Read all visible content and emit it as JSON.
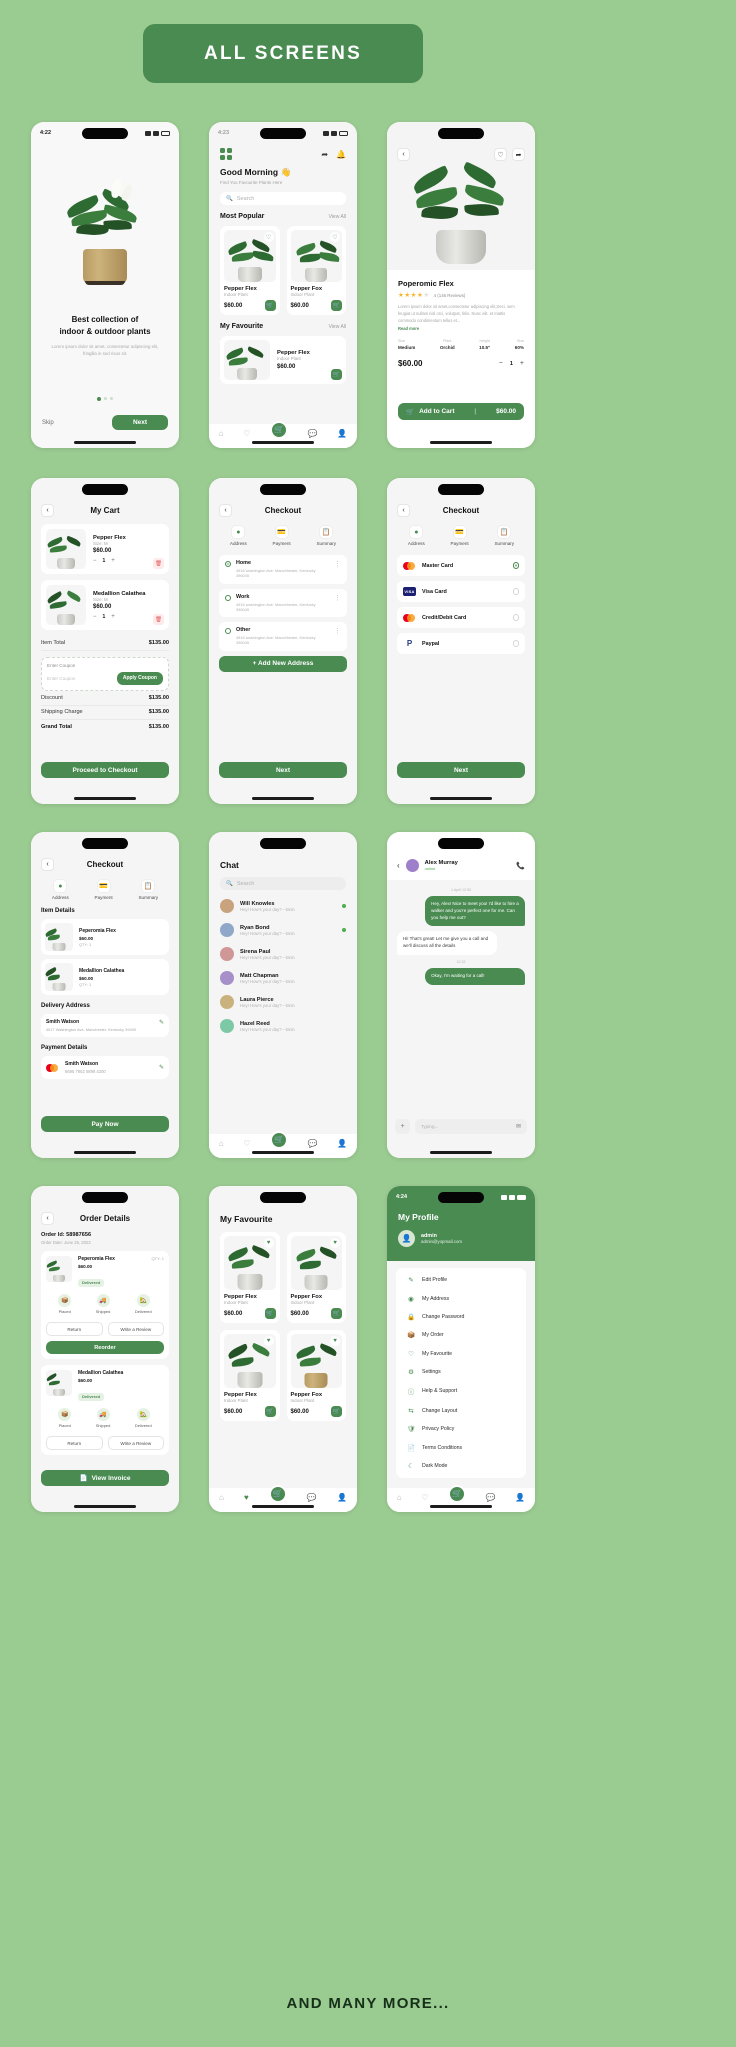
{
  "banner": {
    "title": "ALL SCREENS"
  },
  "footer": {
    "text": "AND MANY MORE..."
  },
  "theme": {
    "bg": "#9ACB91",
    "accent": "#4A8B52",
    "card": "#FFFFFF",
    "screen_bg": "#F4F5F4"
  },
  "screens": [
    {
      "id": "onboarding",
      "status_time": "4:22",
      "headline_line1": "Best collection of",
      "headline_line2": "indoor & outdoor plants",
      "body": "Lorem ipsum dolor sit amet, consectetur adipiscing elit, fringilla in sed risus sit.",
      "skip_label": "Skip",
      "next_label": "Next",
      "dots": 3,
      "active_dot": 0
    },
    {
      "id": "home",
      "status_time": "4:23",
      "greeting": "Good Morning",
      "greeting_emoji": "👋",
      "subtitle": "Find You Favourite Plants Here",
      "search_placeholder": "Search",
      "sections": [
        {
          "title": "Most Popular",
          "view_all": "View All",
          "products": [
            {
              "name": "Pepper Flex",
              "sub": "Indoor Plant",
              "price": "$60.00"
            },
            {
              "name": "Pepper Fox",
              "sub": "Indoor Plant",
              "price": "$60.00"
            }
          ]
        },
        {
          "title": "My Favourite",
          "view_all": "View All",
          "products": [
            {
              "name": "Pepper Flex",
              "sub": "Indoor Plant",
              "price": "$60.00"
            }
          ]
        }
      ],
      "tabs": [
        "home-icon",
        "heart-icon",
        "cart-icon",
        "chat-icon",
        "person-icon"
      ]
    },
    {
      "id": "product-detail",
      "name": "Poperomic Flex",
      "rating_stars": 4,
      "rating_text": "4 (146 Reviews)",
      "description": "Lorem ipsum dolor sit amet,consectetur adipiscing elit,Deci, sem feugiat ut nullam nisl orci, volutpat, felis. Nunc elit. et mattis commodo condimentum tellus et...",
      "read_more": "Read more",
      "specs": [
        {
          "label": "Size",
          "value": "Medium"
        },
        {
          "label": "Plant",
          "value": "Orchid"
        },
        {
          "label": "Height",
          "value": "10.5\""
        },
        {
          "label": "Size",
          "value": "60%"
        }
      ],
      "price": "$60.00",
      "qty": "1",
      "add_to_cart": "Add to Cart",
      "cart_price": "$60.00"
    },
    {
      "id": "my-cart",
      "title": "My Cart",
      "items": [
        {
          "name": "Pepper Flex",
          "sub": "Size: M",
          "price": "$60.00",
          "qty": "1"
        },
        {
          "name": "Medallion Calathea",
          "sub": "Size: M",
          "price": "$60.00",
          "qty": "1"
        }
      ],
      "item_total_label": "Item Total",
      "item_total": "$135.00",
      "coupon_label": "Enter Coupon",
      "coupon_placeholder": "Enter Coupon",
      "apply_label": "Apply Coupon",
      "discount_label": "Discount",
      "discount": "$135.00",
      "shipping_label": "Shipping Charge",
      "shipping": "$135.00",
      "grand_label": "Grand Total",
      "grand": "$135.00",
      "checkout_btn": "Proceed to Checkout"
    },
    {
      "id": "checkout-address",
      "title": "Checkout",
      "steps": [
        {
          "label": "Address",
          "icon": "location-icon"
        },
        {
          "label": "Payment",
          "icon": "wallet-icon"
        },
        {
          "label": "Summary",
          "icon": "clipboard-icon"
        }
      ],
      "addresses": [
        {
          "type": "Home",
          "line": "4516 washington Ave. Manchhester, Kentucky 396045",
          "selected": true
        },
        {
          "type": "Work",
          "line": "4516 washington Ave. Manchhester, Kentucky 396045",
          "selected": false
        },
        {
          "type": "Other",
          "line": "4516 washington Ave. Manchhester, Kentucky 396045",
          "selected": false
        }
      ],
      "add_address": "+   Add New Address",
      "next_btn": "Next"
    },
    {
      "id": "checkout-payment",
      "title": "Checkout",
      "steps": [
        {
          "label": "Address",
          "icon": "location-icon"
        },
        {
          "label": "Payment",
          "icon": "wallet-icon"
        },
        {
          "label": "Summary",
          "icon": "clipboard-icon"
        }
      ],
      "methods": [
        {
          "name": "Master Card",
          "brand": "mastercard",
          "selected": true
        },
        {
          "name": "Visa Card",
          "brand": "visa",
          "selected": false
        },
        {
          "name": "Credit/Debit Card",
          "brand": "mastercard",
          "selected": false
        },
        {
          "name": "Paypal",
          "brand": "paypal",
          "selected": false
        }
      ],
      "next_btn": "Next"
    },
    {
      "id": "checkout-summary",
      "title": "Checkout",
      "steps": [
        {
          "label": "Address",
          "icon": "location-icon"
        },
        {
          "label": "Payment",
          "icon": "wallet-icon"
        },
        {
          "label": "Summary",
          "icon": "clipboard-icon"
        }
      ],
      "item_details_label": "Item Details",
      "items": [
        {
          "name": "Peperomia Flex",
          "price": "$60.00",
          "qty": "QTY: 1"
        },
        {
          "name": "Medallion Calathea",
          "price": "$60.00",
          "qty": "QTY: 1"
        }
      ],
      "delivery_label": "Delivery Address",
      "delivery_name": "Smith Watson",
      "delivery_addr": "4517 Washington Ave. Manchester, Kentucky 39495",
      "payment_label": "Payment Details",
      "payment_name": "Smith Watson",
      "payment_card": "6695 7852 5898 4200",
      "pay_btn": "Pay Now"
    },
    {
      "id": "chat-list",
      "title": "Chat",
      "search_placeholder": "Search",
      "contacts": [
        {
          "name": "Will Knowles",
          "msg": "Hey! How's your day? - 5min",
          "online": true
        },
        {
          "name": "Ryan Bond",
          "msg": "Hey! How's your day? - 5min",
          "online": true
        },
        {
          "name": "Sirena Paul",
          "msg": "Hey! How's your day? - 5min",
          "online": false
        },
        {
          "name": "Matt Chapman",
          "msg": "Hey! How's your day? - 5min",
          "online": false
        },
        {
          "name": "Laura Pierce",
          "msg": "Hey! How's your day? - 5min",
          "online": false
        },
        {
          "name": "Hazel Reed",
          "msg": "Hey! How's your day? - 5min",
          "online": false
        }
      ]
    },
    {
      "id": "chat-thread",
      "name": "Alex Murray",
      "status": "online",
      "date_label": "1 April 12:00",
      "messages": [
        {
          "from": "me",
          "text": "Hey, Alex! Nice to meet you! I'd like to hire a walker and you're perfect one for me. Can you help me out?",
          "time": ""
        },
        {
          "from": "them",
          "text": "Hi! That's great! Let me give you a call and we'll discuss all the details",
          "time": ""
        },
        {
          "from": "me",
          "text": "Okay, I'm waiting for a call!",
          "time": "12:32"
        }
      ],
      "input_placeholder": "Typing..."
    },
    {
      "id": "order-details",
      "title": "Order Details",
      "order_no": "Order Id: 58987656",
      "order_date": "Order Date: June 25, 2023",
      "orders": [
        {
          "name": "Peperomia Flex",
          "price": "$60.00",
          "qty": "QTY: 1",
          "badge": "Delivered",
          "steps": [
            "Placed",
            "Shipped",
            "Delivered"
          ],
          "btn_left": "Return",
          "btn_right": "Write a Review",
          "main_btn": "Reorder"
        },
        {
          "name": "Medallion Calathea",
          "price": "$60.00",
          "qty": "",
          "badge": "Delivered",
          "steps": [
            "Placed",
            "Shipped",
            "Delivered"
          ],
          "btn_left": "Return",
          "btn_right": "Write a Review",
          "main_btn": "View Invoice"
        }
      ]
    },
    {
      "id": "my-favourite",
      "title": "My Favourite",
      "products": [
        {
          "name": "Pepper Flex",
          "sub": "Indoor Plant",
          "price": "$60.00"
        },
        {
          "name": "Pepper Fox",
          "sub": "Indoor Plant",
          "price": "$60.00"
        },
        {
          "name": "Pepper Flex",
          "sub": "Indoor Plant",
          "price": "$60.00"
        },
        {
          "name": "Pepper Fox",
          "sub": "Indoor Plant",
          "price": "$60.00"
        }
      ]
    },
    {
      "id": "my-profile",
      "status_time": "4:24",
      "title": "My Profile",
      "user_name": "admin",
      "user_email": "admin@yopmail.com",
      "menu": [
        {
          "label": "Edit Profile",
          "icon": "user-edit-icon"
        },
        {
          "label": "My Address",
          "icon": "location-icon"
        },
        {
          "label": "Change Password",
          "icon": "lock-icon"
        },
        {
          "label": "My Order",
          "icon": "box-icon"
        },
        {
          "label": "My Favourite",
          "icon": "heart-icon"
        },
        {
          "label": "Settings",
          "icon": "gear-icon"
        },
        {
          "label": "Help & Support",
          "icon": "help-icon"
        },
        {
          "label": "Change Layout",
          "icon": "layout-icon"
        },
        {
          "label": "Privacy Policy",
          "icon": "shield-icon"
        },
        {
          "label": "Terms Conditions",
          "icon": "doc-icon"
        },
        {
          "label": "Dark Mode",
          "icon": "moon-icon"
        }
      ]
    }
  ]
}
